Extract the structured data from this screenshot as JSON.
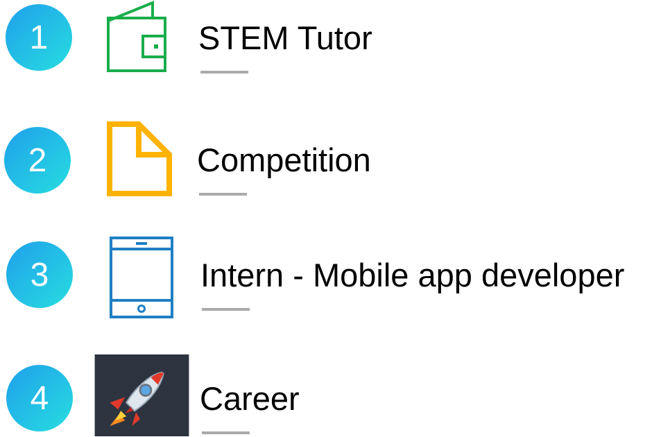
{
  "items": [
    {
      "number": "1",
      "label": "STEM Tutor",
      "icon": "wallet-icon",
      "icon_color": "#1aad4b"
    },
    {
      "number": "2",
      "label": "Competition",
      "icon": "document-icon",
      "icon_color": "#ffb300"
    },
    {
      "number": "3",
      "label": "Intern - Mobile app developer",
      "icon": "tablet-icon",
      "icon_color": "#1f7fc4"
    },
    {
      "number": "4",
      "label": "Career",
      "icon": "rocket-icon",
      "icon_color": "#2d3440"
    }
  ],
  "colors": {
    "circle_gradient_start": "#1fa9e8",
    "circle_gradient_end": "#25d7e0",
    "underline": "#aaaaaa",
    "text": "#000000"
  }
}
